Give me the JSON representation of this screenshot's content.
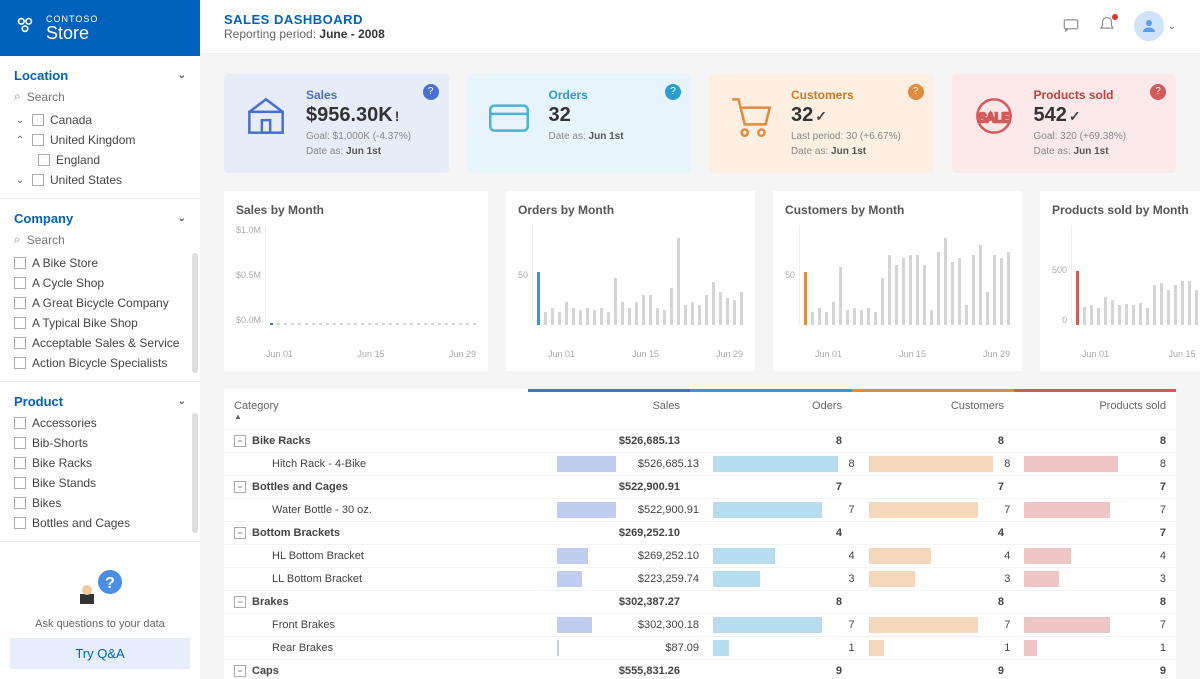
{
  "brand": {
    "small": "CONTOSO",
    "big": "Store"
  },
  "header": {
    "title": "SALES DASHBOARD",
    "period_label": "Reporting period:",
    "period": "June - 2008"
  },
  "sidebar": {
    "location": {
      "title": "Location",
      "search": "Search",
      "items": [
        "Canada",
        "United Kingdom",
        "England",
        "United States"
      ]
    },
    "company": {
      "title": "Company",
      "search": "Search",
      "items": [
        "A Bike Store",
        "A Cycle Shop",
        "A Great Bicycle Company",
        "A Typical Bike Shop",
        "Acceptable Sales & Service",
        "Action Bicycle Specialists"
      ]
    },
    "product": {
      "title": "Product",
      "items": [
        "Accessories",
        "Bib-Shorts",
        "Bike Racks",
        "Bike Stands",
        "Bikes",
        "Bottles and Cages"
      ]
    },
    "qa": {
      "ask": "Ask questions to your data",
      "btn": "Try Q&A"
    }
  },
  "kpi": [
    {
      "cat": "Sales",
      "val": "$956.30K",
      "mark": "!",
      "goal": "Goal: $1,000K (-4.37%)",
      "date_label": "Date as:",
      "date": "Jun 1st"
    },
    {
      "cat": "Orders",
      "val": "32",
      "mark": "",
      "goal": "",
      "date_label": "Date as:",
      "date": "Jun 1st"
    },
    {
      "cat": "Customers",
      "val": "32",
      "mark": "✓",
      "goal": "Last period: 30 (+6.67%)",
      "date_label": "Date as:",
      "date": "Jun 1st"
    },
    {
      "cat": "Products sold",
      "val": "542",
      "mark": "✓",
      "goal": "Goal: 320 (+69.38%)",
      "date_label": "Date as:",
      "date": "Jun 1st"
    }
  ],
  "chart_titles": [
    "Sales by Month",
    "Orders by Month",
    "Customers by Month",
    "Products sold by Month"
  ],
  "chart_data": [
    {
      "type": "bar",
      "title": "Sales by Month",
      "ylabel": "",
      "ylim": [
        0,
        1000000
      ],
      "ticks": [
        "$1.0M",
        "$0.5M",
        "$0.0M"
      ],
      "xticks": [
        "Jun 01",
        "Jun 15",
        "Jun 29"
      ],
      "x": [
        1,
        2,
        3,
        4,
        5,
        6,
        7,
        8,
        9,
        10,
        11,
        12,
        13,
        14,
        15,
        16,
        17,
        18,
        19,
        20,
        21,
        22,
        23,
        24,
        25,
        26,
        27,
        28,
        29,
        30
      ],
      "values": [
        956,
        80,
        160,
        70,
        260,
        160,
        100,
        110,
        100,
        130,
        70,
        120,
        360,
        120,
        220,
        330,
        320,
        120,
        100,
        480,
        190,
        140,
        220,
        160,
        320,
        540,
        360,
        280,
        250,
        380
      ],
      "highlight_color": "#4a6fd4"
    },
    {
      "type": "bar",
      "title": "Orders by Month",
      "ylim": [
        0,
        60
      ],
      "ticks": [
        "",
        "50",
        ""
      ],
      "xticks": [
        "Jun 01",
        "Jun 15",
        "Jun 29"
      ],
      "x": [
        1,
        2,
        3,
        4,
        5,
        6,
        7,
        8,
        9,
        10,
        11,
        12,
        13,
        14,
        15,
        16,
        17,
        18,
        19,
        20,
        21,
        22,
        23,
        24,
        25,
        26,
        27,
        28,
        29,
        30
      ],
      "values": [
        32,
        8,
        10,
        8,
        14,
        10,
        9,
        10,
        9,
        10,
        8,
        28,
        14,
        10,
        14,
        18,
        18,
        10,
        9,
        22,
        52,
        12,
        14,
        12,
        18,
        26,
        20,
        16,
        15,
        20
      ],
      "highlight_color": "#2a9fcf"
    },
    {
      "type": "bar",
      "title": "Customers by Month",
      "ylim": [
        0,
        60
      ],
      "ticks": [
        "",
        "50",
        ""
      ],
      "xticks": [
        "Jun 01",
        "Jun 15",
        "Jun 29"
      ],
      "x": [
        1,
        2,
        3,
        4,
        5,
        6,
        7,
        8,
        9,
        10,
        11,
        12,
        13,
        14,
        15,
        16,
        17,
        18,
        19,
        20,
        21,
        22,
        23,
        24,
        25,
        26,
        27,
        28,
        29,
        30
      ],
      "values": [
        32,
        8,
        10,
        8,
        14,
        35,
        9,
        10,
        9,
        10,
        8,
        28,
        42,
        36,
        40,
        42,
        42,
        36,
        9,
        44,
        52,
        38,
        40,
        12,
        42,
        48,
        20,
        42,
        40,
        44
      ],
      "highlight_color": "#e28b3d"
    },
    {
      "type": "bar",
      "title": "Products sold by Month",
      "ylim": [
        0,
        1000
      ],
      "ticks": [
        "",
        "500",
        "0"
      ],
      "xticks": [
        "Jun 01",
        "Jun 15",
        "Jun 29"
      ],
      "x": [
        1,
        2,
        3,
        4,
        5,
        6,
        7,
        8,
        9,
        10,
        11,
        12,
        13,
        14,
        15,
        16,
        17,
        18,
        19,
        20,
        21,
        22,
        23,
        24,
        25,
        26,
        27,
        28,
        29,
        30
      ],
      "values": [
        542,
        180,
        200,
        170,
        280,
        250,
        200,
        210,
        200,
        220,
        170,
        400,
        420,
        350,
        400,
        440,
        440,
        350,
        200,
        480,
        700,
        380,
        400,
        220,
        440,
        560,
        380,
        440,
        420,
        480
      ],
      "highlight_color": "#d45a5a"
    }
  ],
  "table": {
    "headers": {
      "cat": "Category",
      "sales": "Sales",
      "orders": "Oders",
      "cust": "Customers",
      "prod": "Products sold"
    },
    "rows": [
      {
        "type": "group",
        "cat": "Bike Racks",
        "sales": "$526,685.13",
        "orders": "8",
        "cust": "8",
        "prod": "8"
      },
      {
        "type": "child",
        "cat": "Hitch Rack - 4-Bike",
        "sales": "$526,685.13",
        "orders": "8",
        "cust": "8",
        "prod": "8",
        "bars": {
          "sales": 38,
          "orders": 80,
          "cust": 80,
          "prod": 60
        }
      },
      {
        "type": "group",
        "cat": "Bottles and Cages",
        "sales": "$522,900.91",
        "orders": "7",
        "cust": "7",
        "prod": "7"
      },
      {
        "type": "child",
        "cat": "Water Bottle - 30 oz.",
        "sales": "$522,900.91",
        "orders": "7",
        "cust": "7",
        "prod": "7",
        "bars": {
          "sales": 38,
          "orders": 70,
          "cust": 70,
          "prod": 55
        }
      },
      {
        "type": "group",
        "cat": "Bottom Brackets",
        "sales": "$269,252.10",
        "orders": "4",
        "cust": "4",
        "prod": "7"
      },
      {
        "type": "child",
        "cat": "HL Bottom Bracket",
        "sales": "$269,252.10",
        "orders": "4",
        "cust": "4",
        "prod": "4",
        "bars": {
          "sales": 20,
          "orders": 40,
          "cust": 40,
          "prod": 30
        }
      },
      {
        "type": "child",
        "cat": "LL Bottom Bracket",
        "sales": "$223,259.74",
        "orders": "3",
        "cust": "3",
        "prod": "3",
        "bars": {
          "sales": 16,
          "orders": 30,
          "cust": 30,
          "prod": 22
        }
      },
      {
        "type": "group",
        "cat": "Brakes",
        "sales": "$302,387.27",
        "orders": "8",
        "cust": "8",
        "prod": "8"
      },
      {
        "type": "child",
        "cat": "Front Brakes",
        "sales": "$302,300.18",
        "orders": "7",
        "cust": "7",
        "prod": "7",
        "bars": {
          "sales": 22,
          "orders": 70,
          "cust": 70,
          "prod": 55
        }
      },
      {
        "type": "child",
        "cat": "Rear Brakes",
        "sales": "$87.09",
        "orders": "1",
        "cust": "1",
        "prod": "1",
        "bars": {
          "sales": 1,
          "orders": 10,
          "cust": 10,
          "prod": 8
        }
      },
      {
        "type": "group",
        "cat": "Caps",
        "sales": "$555,831.26",
        "orders": "9",
        "cust": "9",
        "prod": "9"
      }
    ]
  }
}
